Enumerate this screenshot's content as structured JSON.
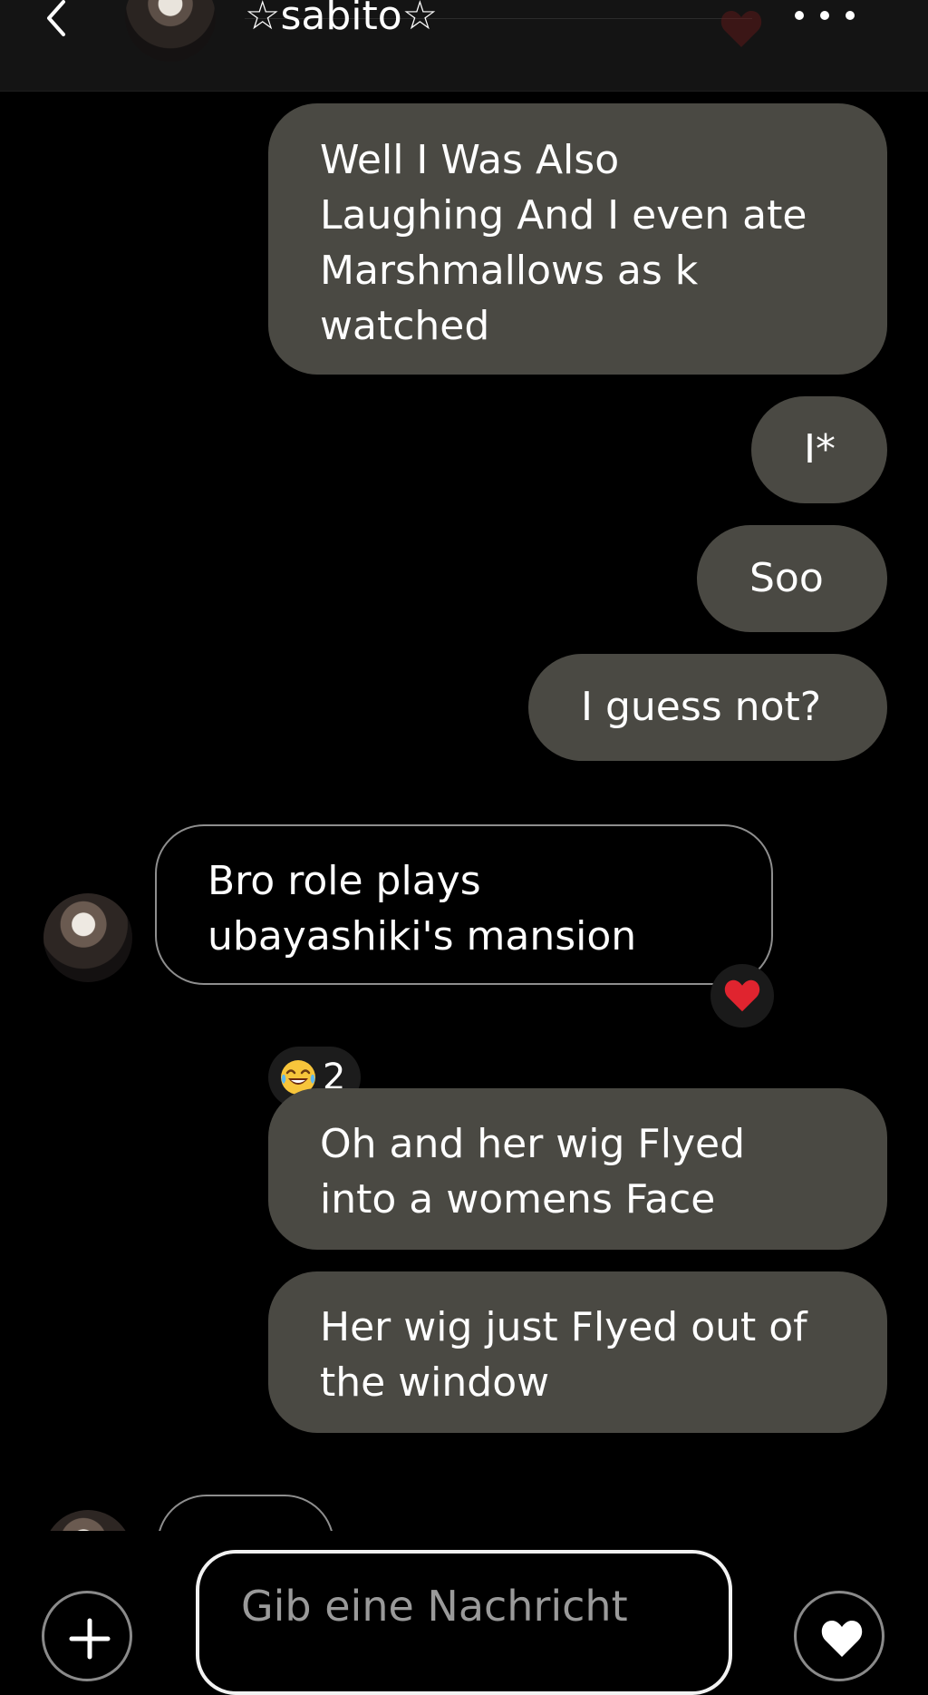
{
  "header": {
    "title": "☆sabito☆",
    "back_icon": "chevron-left-icon",
    "more_icon": "more-horizontal-icon",
    "heart_icon": "heart-icon"
  },
  "messages": [
    {
      "direction": "outgoing",
      "lines": [
        "Well I Was Also",
        "Laughing And I even ate",
        "Marshmallows as k",
        "watched"
      ]
    },
    {
      "direction": "outgoing",
      "lines": [
        "I*"
      ]
    },
    {
      "direction": "outgoing",
      "lines": [
        "Soo"
      ]
    },
    {
      "direction": "outgoing",
      "lines": [
        "I guess not?"
      ]
    },
    {
      "direction": "incoming",
      "lines": [
        "Bro role plays",
        "ubayashiki's mansion"
      ],
      "reaction": "heart"
    },
    {
      "direction": "outgoing",
      "lines": [
        "Oh and her wig Flyed",
        "into a womens Face"
      ],
      "reaction": {
        "emoji": "face-with-tears-of-joy",
        "count": "2"
      }
    },
    {
      "direction": "outgoing",
      "lines": [
        "Her wig just Flyed out of",
        "the window"
      ]
    }
  ],
  "composer": {
    "placeholder": "Gib eine Nachricht",
    "add_icon": "plus-icon",
    "like_icon": "heart-icon"
  },
  "colors": {
    "background": "#000000",
    "outgoing_bubble": "#4a4943",
    "incoming_border": "#8e8e8e",
    "heart_red": "#e0242f",
    "input_border": "#f2f2f2",
    "placeholder": "#9a9a9a"
  }
}
